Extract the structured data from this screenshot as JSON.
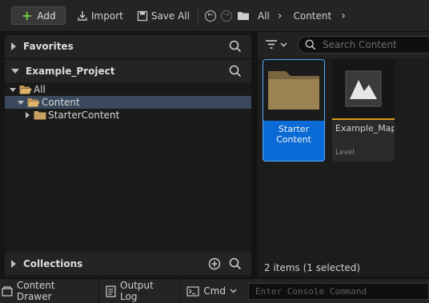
{
  "toolbar": {
    "add_label": "Add",
    "import_label": "Import",
    "save_all_label": "Save All",
    "breadcrumb": [
      "All",
      "Content"
    ]
  },
  "sources": {
    "favorites_label": "Favorites",
    "project_label": "Example_Project",
    "collections_label": "Collections",
    "tree": [
      {
        "label": "All",
        "expanded": true
      },
      {
        "label": "Content",
        "expanded": true,
        "selected": true
      },
      {
        "label": "StarterContent",
        "expanded": false
      }
    ]
  },
  "content": {
    "search_placeholder": "Search Content",
    "items": [
      {
        "name_line1": "Starter",
        "name_line2": "Content",
        "type": "folder",
        "selected": true
      },
      {
        "name": "Example_Map",
        "type_label": "Level",
        "selected": false
      }
    ],
    "status": "2 items (1 selected)"
  },
  "bottom": {
    "content_drawer": "Content Drawer",
    "output_log": "Output Log",
    "cmd": "Cmd",
    "console_placeholder": "Enter Console Command"
  },
  "colors": {
    "accent_green": "#6fcf3c",
    "selection_blue": "#0a6bd6",
    "level_underline": "#d99a18"
  }
}
